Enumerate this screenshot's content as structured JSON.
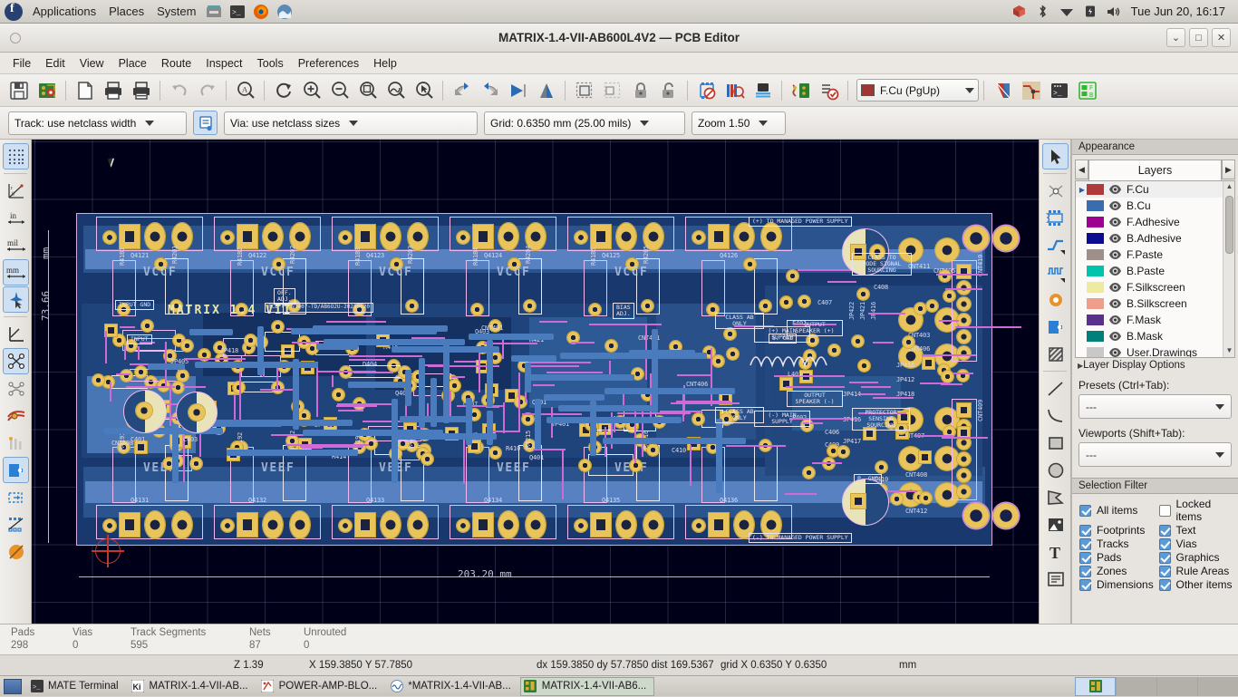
{
  "desktop_panel": {
    "menus": [
      "Applications",
      "Places",
      "System"
    ],
    "launchers": [
      "files-icon",
      "terminal-icon",
      "firefox-icon",
      "browser-icon"
    ],
    "tray": [
      "package-icon",
      "bluetooth-icon",
      "wifi-icon",
      "battery-icon",
      "volume-icon"
    ],
    "clock": "Tue Jun 20, 16:17"
  },
  "window": {
    "title": "MATRIX-1.4-VII-AB600L4V2 — PCB Editor",
    "buttons": [
      "minimize-button",
      "maximize-button",
      "close-button"
    ],
    "button_glyphs": [
      "⌄",
      "□",
      "✕"
    ]
  },
  "menubar": {
    "items": [
      "File",
      "Edit",
      "View",
      "Place",
      "Route",
      "Inspect",
      "Tools",
      "Preferences",
      "Help"
    ]
  },
  "toolbar_top": {
    "buttons": [
      "save-icon",
      "board-setup-icon",
      "page-settings-icon",
      "print-icon",
      "plot-icon",
      "undo-icon",
      "redo-icon",
      "find-icon",
      "refresh-icon",
      "zoom-in-icon",
      "zoom-out-icon",
      "zoom-fit-icon",
      "zoom-objects-icon",
      "zoom-selection-icon",
      "rotate-ccw-icon",
      "rotate-cw-icon",
      "flip-horizontal-icon",
      "mirror-icon",
      "group-icon",
      "ungroup-icon",
      "lock-icon",
      "unlock-icon",
      "footprint-editor-icon",
      "footprint-library-icon",
      "3d-viewer-icon",
      "netlist-icon",
      "drc-icon"
    ],
    "layer_selector": {
      "value": "F.Cu (PgUp)",
      "color": "#a03634"
    },
    "right_buttons": [
      "layer-pairs-icon",
      "route-icon",
      "scripting-console-icon",
      "fp-checker-icon"
    ]
  },
  "toolbar_selectors": {
    "track_width": "Track: use netclass width",
    "track_edit_button": "track-properties-icon",
    "via_size": "Via: use netclass sizes",
    "grid": "Grid: 0.6350 mm (25.00 mils)",
    "zoom": "Zoom 1.50"
  },
  "toolbar_left": {
    "buttons": [
      {
        "name": "toggle-grid-icon",
        "glyph": "grid",
        "active": true
      },
      {
        "name": "polar-coordinates-icon",
        "glyph": "polar",
        "active": false
      },
      {
        "name": "units-inches-icon",
        "glyph": "in",
        "active": false
      },
      {
        "name": "units-mils-icon",
        "glyph": "mil",
        "active": false
      },
      {
        "name": "units-millimeters-icon",
        "glyph": "mm",
        "active": true
      },
      {
        "name": "full-crosshair-icon",
        "glyph": "cursor",
        "active": true
      },
      {
        "name": "show-ratsnest-icon",
        "glyph": "ratsnest-l",
        "active": false
      },
      {
        "name": "ratsnest-straight-icon",
        "glyph": "ratsnest",
        "active": true
      },
      {
        "name": "ratsnest-curved-icon",
        "glyph": "ratsnest-curve",
        "active": false
      },
      {
        "name": "zones-filled-icon",
        "glyph": "zone-filled",
        "active": false
      },
      {
        "name": "zones-outline-icon",
        "glyph": "zone-outline",
        "active": false
      },
      {
        "name": "pads-sketch-icon",
        "glyph": "pad-sketch",
        "active": true
      },
      {
        "name": "vias-sketch-icon",
        "glyph": "via-sketch",
        "active": false
      },
      {
        "name": "tracks-sketch-icon",
        "glyph": "track-sketch",
        "active": false
      },
      {
        "name": "contrast-mode-icon",
        "glyph": "contrast",
        "active": false
      }
    ]
  },
  "toolbar_right": {
    "buttons": [
      {
        "name": "select-tool-icon",
        "glyph": "cursor",
        "active": true
      },
      {
        "name": "local-ratsnest-icon",
        "glyph": "ratsnest-x",
        "active": false
      },
      {
        "name": "add-footprint-icon",
        "glyph": "footprint",
        "active": false
      },
      {
        "name": "route-tracks-icon",
        "glyph": "route",
        "active": false
      },
      {
        "name": "tune-length-icon",
        "glyph": "meander",
        "active": false
      },
      {
        "name": "add-via-icon",
        "glyph": "via",
        "active": false
      },
      {
        "name": "add-zone-icon",
        "glyph": "zone",
        "active": false
      },
      {
        "name": "add-rule-area-icon",
        "glyph": "rule-area",
        "active": false
      },
      {
        "name": "draw-line-icon",
        "glyph": "line",
        "active": false
      },
      {
        "name": "draw-arc-icon",
        "glyph": "arc",
        "active": false
      },
      {
        "name": "draw-rectangle-icon",
        "glyph": "rect",
        "active": false
      },
      {
        "name": "draw-circle-icon",
        "glyph": "circle",
        "active": false
      },
      {
        "name": "draw-polygon-icon",
        "glyph": "polygon",
        "active": false
      },
      {
        "name": "add-image-icon",
        "glyph": "image",
        "active": false
      },
      {
        "name": "add-text-icon",
        "glyph": "text",
        "active": false
      },
      {
        "name": "add-textbox-icon",
        "glyph": "textbox",
        "active": false
      }
    ]
  },
  "appearance": {
    "header": "Appearance",
    "tab_label": "Layers",
    "layers": [
      {
        "name": "F.Cu",
        "color": "#b03a3a",
        "visible": true,
        "selected": true
      },
      {
        "name": "B.Cu",
        "color": "#3a6db0",
        "visible": true,
        "selected": false
      },
      {
        "name": "F.Adhesive",
        "color": "#a0008f",
        "visible": true,
        "selected": false
      },
      {
        "name": "B.Adhesive",
        "color": "#0b0b8f",
        "visible": true,
        "selected": false
      },
      {
        "name": "F.Paste",
        "color": "#9d8f8a",
        "visible": true,
        "selected": false
      },
      {
        "name": "B.Paste",
        "color": "#00c3ae",
        "visible": true,
        "selected": false
      },
      {
        "name": "F.Silkscreen",
        "color": "#eeeba0",
        "visible": true,
        "selected": false
      },
      {
        "name": "B.Silkscreen",
        "color": "#ef9e8a",
        "visible": true,
        "selected": false
      },
      {
        "name": "F.Mask",
        "color": "#5b2f8e",
        "visible": true,
        "selected": false
      },
      {
        "name": "B.Mask",
        "color": "#00807a",
        "visible": true,
        "selected": false
      },
      {
        "name": "User.Drawings",
        "color": "#c8c8c8",
        "visible": true,
        "selected": false
      }
    ],
    "layer_display_options": "Layer Display Options",
    "presets_label": "Presets (Ctrl+Tab):",
    "presets_value": "---",
    "viewports_label": "Viewports (Shift+Tab):",
    "viewports_value": "---",
    "selection_filter": {
      "header": "Selection Filter",
      "items": [
        {
          "label": "All items",
          "checked": true
        },
        {
          "label": "Locked items",
          "checked": false
        },
        {
          "label": "Footprints",
          "checked": true
        },
        {
          "label": "Text",
          "checked": true
        },
        {
          "label": "Tracks",
          "checked": true
        },
        {
          "label": "Vias",
          "checked": true
        },
        {
          "label": "Pads",
          "checked": true
        },
        {
          "label": "Graphics",
          "checked": true
        },
        {
          "label": "Zones",
          "checked": true
        },
        {
          "label": "Rule Areas",
          "checked": true
        },
        {
          "label": "Dimensions",
          "checked": true
        },
        {
          "label": "Other items",
          "checked": true
        }
      ]
    }
  },
  "canvas": {
    "board_title": "MATRIX 1.4 VII",
    "board_revision": "PCB V. N1407-TD/AB6O2U-20230620",
    "dimension_width": "203.20  mm",
    "dimension_height": "73.66",
    "dimension_unit": "mm",
    "vccf_labels": [
      "VCCF",
      "VCCF",
      "VCCF",
      "VCCF",
      "VCCF"
    ],
    "veef_labels": [
      "VEEF",
      "VEEF",
      "VEEF",
      "VEEF",
      "VEEF"
    ],
    "transistor_top": [
      "Q4121",
      "Q4122",
      "Q4123",
      "Q4124",
      "Q4125",
      "Q4126"
    ],
    "transistor_bottom": [
      "Q4131",
      "Q4132",
      "Q4133",
      "Q4134",
      "Q4135",
      "Q4136"
    ],
    "resistor_top": [
      "R41B1",
      "R4201",
      "R41B2",
      "R4202",
      "R41B3",
      "R4203",
      "R41B4",
      "R4204",
      "R41B5",
      "R4205"
    ],
    "resistor_bottom": [
      "R4191",
      "R4211",
      "R4192",
      "R4212",
      "R4193",
      "R4213",
      "R4194",
      "R4215",
      "R4195",
      "R4216"
    ],
    "text_callouts": [
      "(+) TO MANAGED POWER SUPPLY",
      "(-) TO MANAGED POWER SUPPLY",
      "(+) MAIN SUPPLY",
      "CLASS TO MODE SIGNAL SOURCING",
      "CLASS AB ONLY",
      "PROTECTOR SENSING SOURCING",
      "OUTPUT SPEAKER (+)",
      "OUTPUT SPEAKER (-)",
      "INPUT GND",
      "INPUT",
      "OFF. ADJ.",
      "BIAS ADJ.",
      "S. GND",
      "P. GND"
    ],
    "component_refs": [
      "CNT401",
      "CNT402",
      "CNT403",
      "CNT405",
      "CNT406",
      "CNT407",
      "CNT408",
      "CNT410",
      "CNT411",
      "CNT412",
      "R401",
      "R402",
      "R403",
      "R408",
      "R409",
      "R410",
      "R411",
      "R413",
      "R414",
      "R415",
      "R417",
      "R421",
      "R422",
      "R443",
      "R471",
      "R472",
      "C401",
      "C402",
      "C403",
      "C404",
      "C405",
      "C406",
      "C407",
      "C408",
      "C409",
      "C410",
      "D402",
      "D403",
      "D404",
      "D405",
      "D406",
      "Q401",
      "Q402",
      "Q403",
      "Q405",
      "Q406",
      "Q407",
      "Q408",
      "F401",
      "F402",
      "RT401",
      "L401",
      "JP401",
      "JP402",
      "JP403",
      "JP405",
      "JP406",
      "JP411",
      "JP414",
      "JP416",
      "JP417",
      "JP418",
      "JP421",
      "JP422"
    ]
  },
  "status": {
    "counts": [
      {
        "label": "Pads",
        "value": "298"
      },
      {
        "label": "Vias",
        "value": "0"
      },
      {
        "label": "Track Segments",
        "value": "595"
      },
      {
        "label": "Nets",
        "value": "87"
      },
      {
        "label": "Unrouted",
        "value": "0"
      }
    ],
    "zoom": "Z 1.39",
    "position": "X 159.3850  Y 57.7850",
    "delta": "dx 159.3850  dy 57.7850  dist 169.5367",
    "grid": "grid X 0.6350  Y 0.6350",
    "units": "mm"
  },
  "taskbar": {
    "tasks": [
      {
        "label": "MATE Terminal",
        "icon": "terminal-icon",
        "active": false
      },
      {
        "label": "MATRIX-1.4-VII-AB...",
        "icon": "kicad-icon",
        "active": false
      },
      {
        "label": "POWER-AMP-BLO...",
        "icon": "schematic-icon",
        "active": false
      },
      {
        "label": "*MATRIX-1.4-VII-AB...",
        "icon": "simulator-icon",
        "active": false
      },
      {
        "label": "MATRIX-1.4-VII-AB6...",
        "icon": "pcb-icon",
        "active": true
      }
    ]
  }
}
